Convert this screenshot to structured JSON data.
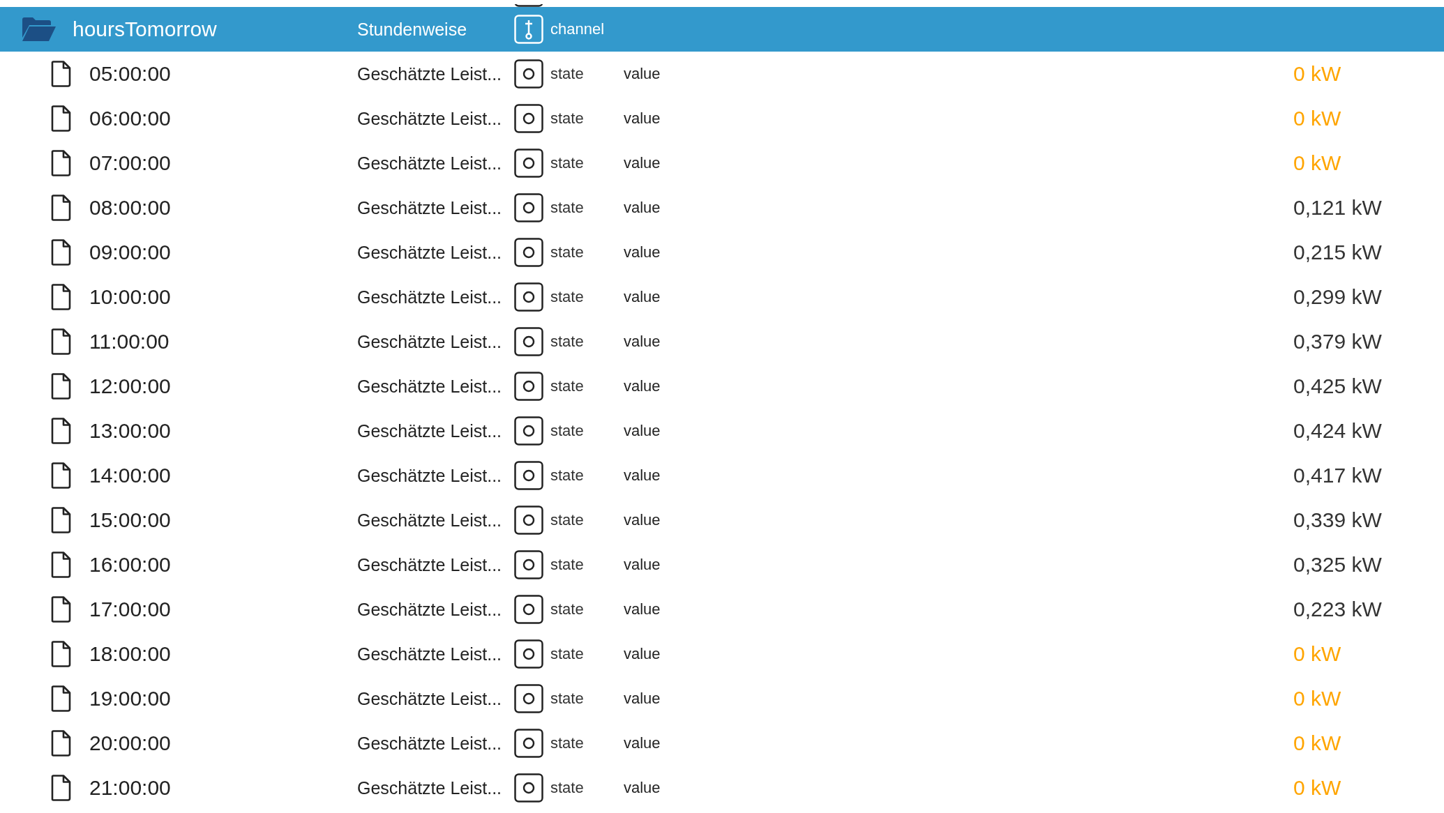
{
  "folder": {
    "name": "hoursTomorrow",
    "description": "Stundenweise",
    "type": "channel"
  },
  "rows": [
    {
      "name": "05:00:00",
      "description": "Geschätzte Leist...",
      "type": "state",
      "role": "value",
      "value": "0 kW",
      "color": "#ffa500"
    },
    {
      "name": "06:00:00",
      "description": "Geschätzte Leist...",
      "type": "state",
      "role": "value",
      "value": "0 kW",
      "color": "#ffa500"
    },
    {
      "name": "07:00:00",
      "description": "Geschätzte Leist...",
      "type": "state",
      "role": "value",
      "value": "0 kW",
      "color": "#ffa500"
    },
    {
      "name": "08:00:00",
      "description": "Geschätzte Leist...",
      "type": "state",
      "role": "value",
      "value": "0,121 kW",
      "color": "#333333"
    },
    {
      "name": "09:00:00",
      "description": "Geschätzte Leist...",
      "type": "state",
      "role": "value",
      "value": "0,215 kW",
      "color": "#333333"
    },
    {
      "name": "10:00:00",
      "description": "Geschätzte Leist...",
      "type": "state",
      "role": "value",
      "value": "0,299 kW",
      "color": "#333333"
    },
    {
      "name": "11:00:00",
      "description": "Geschätzte Leist...",
      "type": "state",
      "role": "value",
      "value": "0,379 kW",
      "color": "#333333"
    },
    {
      "name": "12:00:00",
      "description": "Geschätzte Leist...",
      "type": "state",
      "role": "value",
      "value": "0,425 kW",
      "color": "#333333"
    },
    {
      "name": "13:00:00",
      "description": "Geschätzte Leist...",
      "type": "state",
      "role": "value",
      "value": "0,424 kW",
      "color": "#333333"
    },
    {
      "name": "14:00:00",
      "description": "Geschätzte Leist...",
      "type": "state",
      "role": "value",
      "value": "0,417 kW",
      "color": "#333333"
    },
    {
      "name": "15:00:00",
      "description": "Geschätzte Leist...",
      "type": "state",
      "role": "value",
      "value": "0,339 kW",
      "color": "#333333"
    },
    {
      "name": "16:00:00",
      "description": "Geschätzte Leist...",
      "type": "state",
      "role": "value",
      "value": "0,325 kW",
      "color": "#333333"
    },
    {
      "name": "17:00:00",
      "description": "Geschätzte Leist...",
      "type": "state",
      "role": "value",
      "value": "0,223 kW",
      "color": "#333333"
    },
    {
      "name": "18:00:00",
      "description": "Geschätzte Leist...",
      "type": "state",
      "role": "value",
      "value": "0 kW",
      "color": "#ffa500"
    },
    {
      "name": "19:00:00",
      "description": "Geschätzte Leist...",
      "type": "state",
      "role": "value",
      "value": "0 kW",
      "color": "#ffa500"
    },
    {
      "name": "20:00:00",
      "description": "Geschätzte Leist...",
      "type": "state",
      "role": "value",
      "value": "0 kW",
      "color": "#ffa500"
    },
    {
      "name": "21:00:00",
      "description": "Geschätzte Leist...",
      "type": "state",
      "role": "value",
      "value": "0 kW",
      "color": "#ffa500"
    }
  ]
}
